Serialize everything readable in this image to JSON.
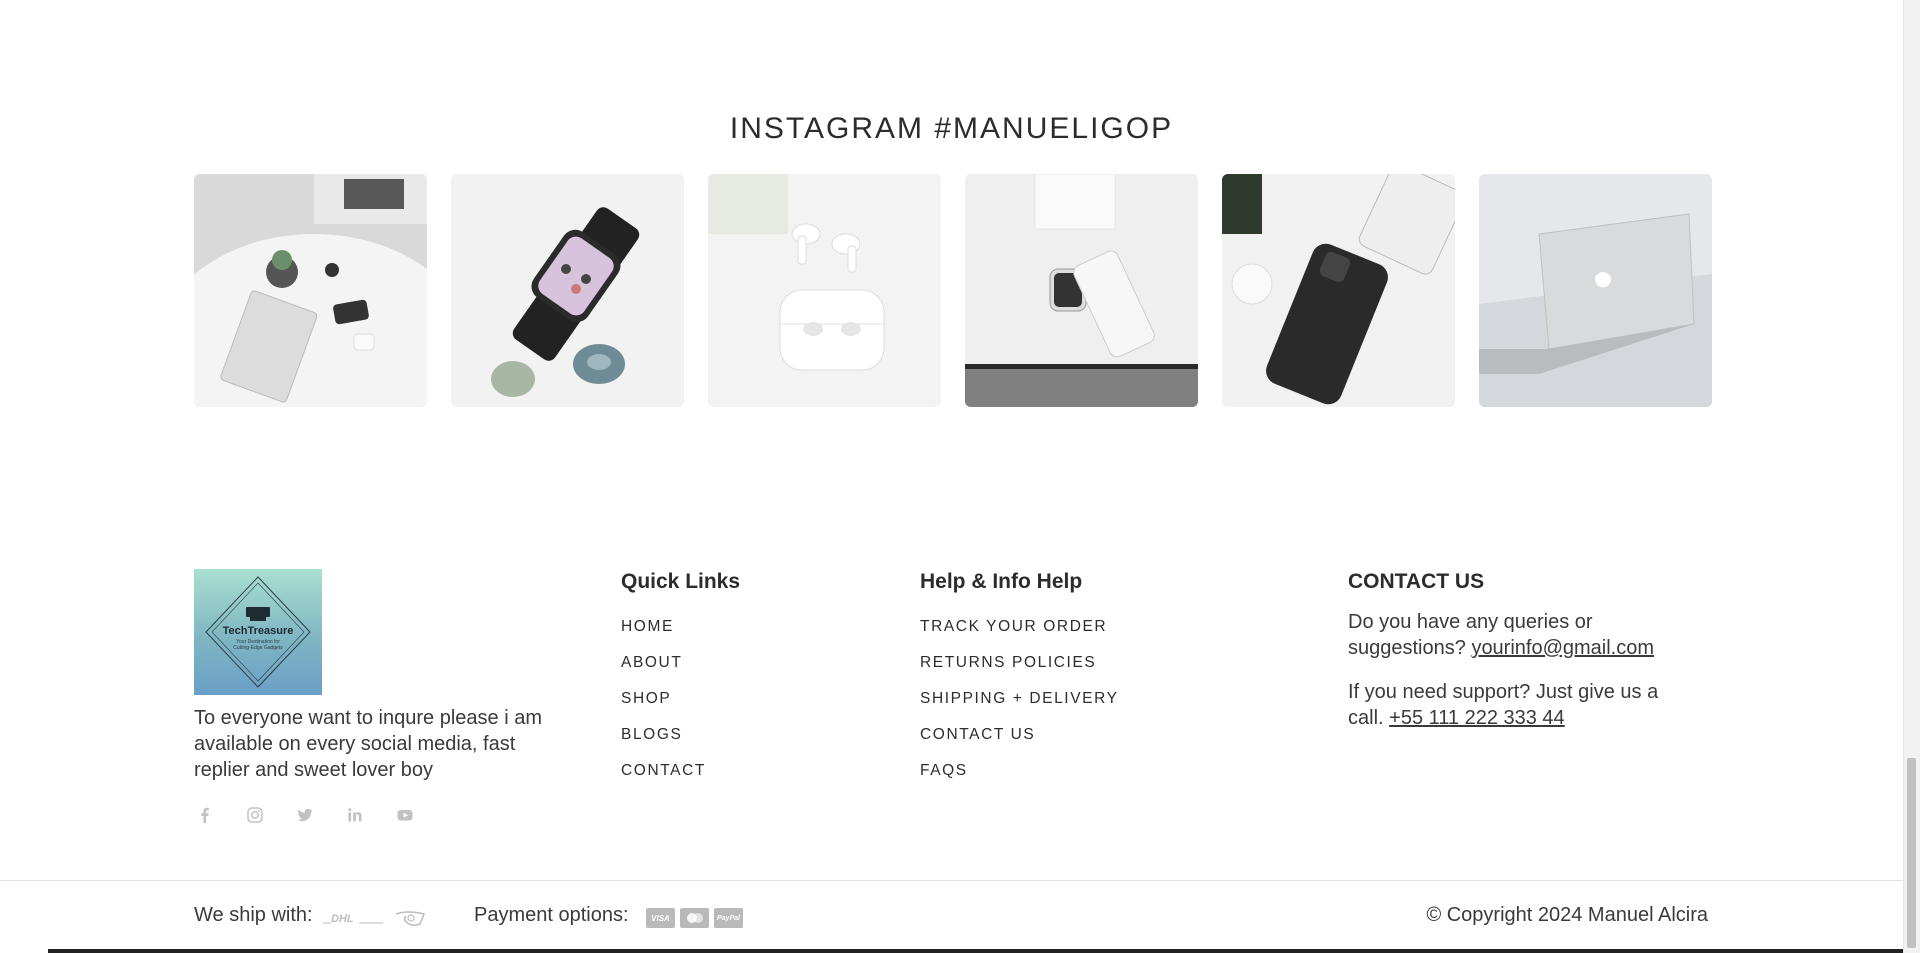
{
  "instagram": {
    "title": "INSTAGRAM #MANUELIGOP",
    "tiles": [
      "tile-ipad-desk",
      "tile-smartwatch",
      "tile-airpods",
      "tile-watch-phone",
      "tile-iphone",
      "tile-macbook"
    ]
  },
  "footer": {
    "logo": {
      "name": "TechTreasure",
      "tagline_line1": "Your Destination for",
      "tagline_line2": "Cutting-Edge Gadgets"
    },
    "about": "To everyone want to inqure please i am available on every social media, fast replier and sweet lover boy",
    "socials": [
      "facebook-icon",
      "instagram-icon",
      "twitter-icon",
      "linkedin-icon",
      "youtube-icon"
    ],
    "quick_links": {
      "title": "Quick Links",
      "items": [
        "HOME",
        "ABOUT",
        "SHOP",
        "BLOGS",
        "CONTACT"
      ]
    },
    "help": {
      "title": "Help & Info Help",
      "items": [
        "TRACK YOUR ORDER",
        "RETURNS POLICIES",
        "SHIPPING + DELIVERY",
        "CONTACT US",
        "FAQS"
      ]
    },
    "contact": {
      "title": "CONTACT US",
      "query_text": "Do you have any queries or suggestions?",
      "email": "yourinfo@gmail.com",
      "support_text": "If you need support? Just give us a call.",
      "phone": "+55 111 222 333 44"
    },
    "bottom": {
      "ship_label": "We ship with:",
      "ship_logos": [
        "DHL",
        "post-horn-icon"
      ],
      "payment_label": "Payment options:",
      "payment_logos": [
        "VISA",
        "MC",
        "PayPal"
      ],
      "copyright": "© Copyright 2024 Manuel Alcira"
    }
  },
  "colors": {
    "text": "#3a3a3a",
    "muted_icon": "#c2c2c2",
    "divider": "#e3e3e3",
    "logo_top": "#a9e0cf",
    "logo_bottom": "#6a9fc7"
  }
}
